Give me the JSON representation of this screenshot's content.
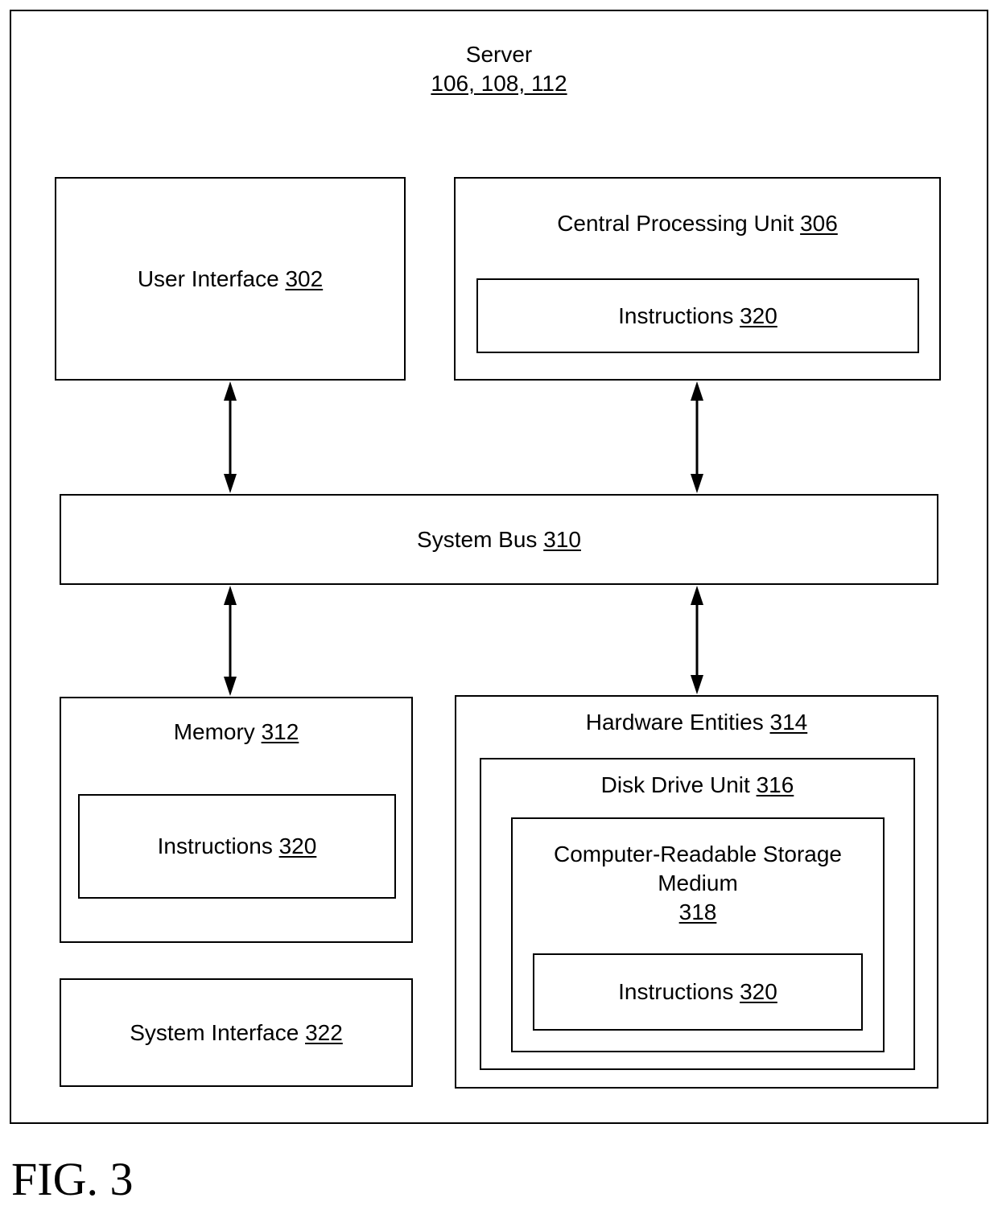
{
  "server": {
    "title": "Server",
    "refs": "106, 108, 112"
  },
  "user_interface": {
    "label": "User Interface ",
    "ref": "302"
  },
  "cpu": {
    "label": "Central Processing Unit ",
    "ref": "306",
    "instructions": {
      "label": "Instructions ",
      "ref": "320"
    }
  },
  "system_bus": {
    "label": "System Bus ",
    "ref": "310"
  },
  "memory": {
    "label": "Memory ",
    "ref": "312",
    "instructions": {
      "label": "Instructions ",
      "ref": "320"
    }
  },
  "system_interface": {
    "label": "System Interface ",
    "ref": "322"
  },
  "hardware_entities": {
    "label": "Hardware Entities ",
    "ref": "314"
  },
  "disk_drive": {
    "label": "Disk Drive Unit ",
    "ref": "316"
  },
  "storage_medium": {
    "line1": "Computer-Readable Storage",
    "line2": "Medium",
    "ref": "318",
    "instructions": {
      "label": "Instructions ",
      "ref": "320"
    }
  },
  "figure_label": "FIG. 3"
}
